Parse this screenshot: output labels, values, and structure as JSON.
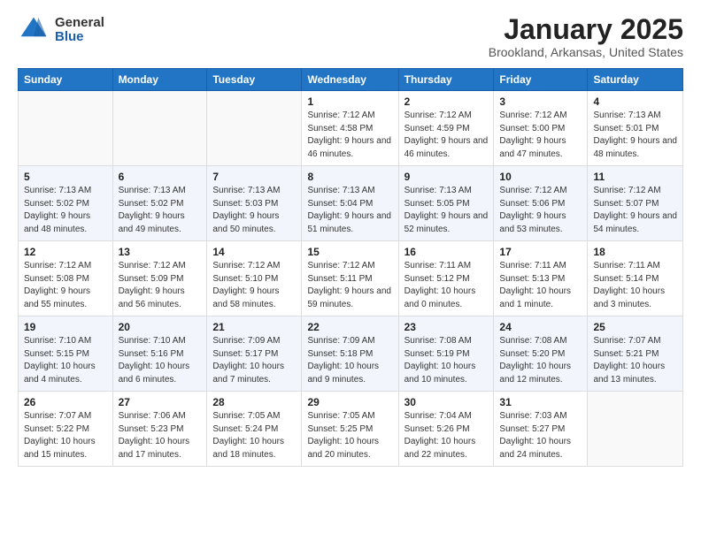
{
  "logo": {
    "general": "General",
    "blue": "Blue"
  },
  "header": {
    "month": "January 2025",
    "location": "Brookland, Arkansas, United States"
  },
  "weekdays": [
    "Sunday",
    "Monday",
    "Tuesday",
    "Wednesday",
    "Thursday",
    "Friday",
    "Saturday"
  ],
  "weeks": [
    [
      {
        "day": "",
        "info": ""
      },
      {
        "day": "",
        "info": ""
      },
      {
        "day": "",
        "info": ""
      },
      {
        "day": "1",
        "info": "Sunrise: 7:12 AM\nSunset: 4:58 PM\nDaylight: 9 hours and 46 minutes."
      },
      {
        "day": "2",
        "info": "Sunrise: 7:12 AM\nSunset: 4:59 PM\nDaylight: 9 hours and 46 minutes."
      },
      {
        "day": "3",
        "info": "Sunrise: 7:12 AM\nSunset: 5:00 PM\nDaylight: 9 hours and 47 minutes."
      },
      {
        "day": "4",
        "info": "Sunrise: 7:13 AM\nSunset: 5:01 PM\nDaylight: 9 hours and 48 minutes."
      }
    ],
    [
      {
        "day": "5",
        "info": "Sunrise: 7:13 AM\nSunset: 5:02 PM\nDaylight: 9 hours and 48 minutes."
      },
      {
        "day": "6",
        "info": "Sunrise: 7:13 AM\nSunset: 5:02 PM\nDaylight: 9 hours and 49 minutes."
      },
      {
        "day": "7",
        "info": "Sunrise: 7:13 AM\nSunset: 5:03 PM\nDaylight: 9 hours and 50 minutes."
      },
      {
        "day": "8",
        "info": "Sunrise: 7:13 AM\nSunset: 5:04 PM\nDaylight: 9 hours and 51 minutes."
      },
      {
        "day": "9",
        "info": "Sunrise: 7:13 AM\nSunset: 5:05 PM\nDaylight: 9 hours and 52 minutes."
      },
      {
        "day": "10",
        "info": "Sunrise: 7:12 AM\nSunset: 5:06 PM\nDaylight: 9 hours and 53 minutes."
      },
      {
        "day": "11",
        "info": "Sunrise: 7:12 AM\nSunset: 5:07 PM\nDaylight: 9 hours and 54 minutes."
      }
    ],
    [
      {
        "day": "12",
        "info": "Sunrise: 7:12 AM\nSunset: 5:08 PM\nDaylight: 9 hours and 55 minutes."
      },
      {
        "day": "13",
        "info": "Sunrise: 7:12 AM\nSunset: 5:09 PM\nDaylight: 9 hours and 56 minutes."
      },
      {
        "day": "14",
        "info": "Sunrise: 7:12 AM\nSunset: 5:10 PM\nDaylight: 9 hours and 58 minutes."
      },
      {
        "day": "15",
        "info": "Sunrise: 7:12 AM\nSunset: 5:11 PM\nDaylight: 9 hours and 59 minutes."
      },
      {
        "day": "16",
        "info": "Sunrise: 7:11 AM\nSunset: 5:12 PM\nDaylight: 10 hours and 0 minutes."
      },
      {
        "day": "17",
        "info": "Sunrise: 7:11 AM\nSunset: 5:13 PM\nDaylight: 10 hours and 1 minute."
      },
      {
        "day": "18",
        "info": "Sunrise: 7:11 AM\nSunset: 5:14 PM\nDaylight: 10 hours and 3 minutes."
      }
    ],
    [
      {
        "day": "19",
        "info": "Sunrise: 7:10 AM\nSunset: 5:15 PM\nDaylight: 10 hours and 4 minutes."
      },
      {
        "day": "20",
        "info": "Sunrise: 7:10 AM\nSunset: 5:16 PM\nDaylight: 10 hours and 6 minutes."
      },
      {
        "day": "21",
        "info": "Sunrise: 7:09 AM\nSunset: 5:17 PM\nDaylight: 10 hours and 7 minutes."
      },
      {
        "day": "22",
        "info": "Sunrise: 7:09 AM\nSunset: 5:18 PM\nDaylight: 10 hours and 9 minutes."
      },
      {
        "day": "23",
        "info": "Sunrise: 7:08 AM\nSunset: 5:19 PM\nDaylight: 10 hours and 10 minutes."
      },
      {
        "day": "24",
        "info": "Sunrise: 7:08 AM\nSunset: 5:20 PM\nDaylight: 10 hours and 12 minutes."
      },
      {
        "day": "25",
        "info": "Sunrise: 7:07 AM\nSunset: 5:21 PM\nDaylight: 10 hours and 13 minutes."
      }
    ],
    [
      {
        "day": "26",
        "info": "Sunrise: 7:07 AM\nSunset: 5:22 PM\nDaylight: 10 hours and 15 minutes."
      },
      {
        "day": "27",
        "info": "Sunrise: 7:06 AM\nSunset: 5:23 PM\nDaylight: 10 hours and 17 minutes."
      },
      {
        "day": "28",
        "info": "Sunrise: 7:05 AM\nSunset: 5:24 PM\nDaylight: 10 hours and 18 minutes."
      },
      {
        "day": "29",
        "info": "Sunrise: 7:05 AM\nSunset: 5:25 PM\nDaylight: 10 hours and 20 minutes."
      },
      {
        "day": "30",
        "info": "Sunrise: 7:04 AM\nSunset: 5:26 PM\nDaylight: 10 hours and 22 minutes."
      },
      {
        "day": "31",
        "info": "Sunrise: 7:03 AM\nSunset: 5:27 PM\nDaylight: 10 hours and 24 minutes."
      },
      {
        "day": "",
        "info": ""
      }
    ]
  ]
}
